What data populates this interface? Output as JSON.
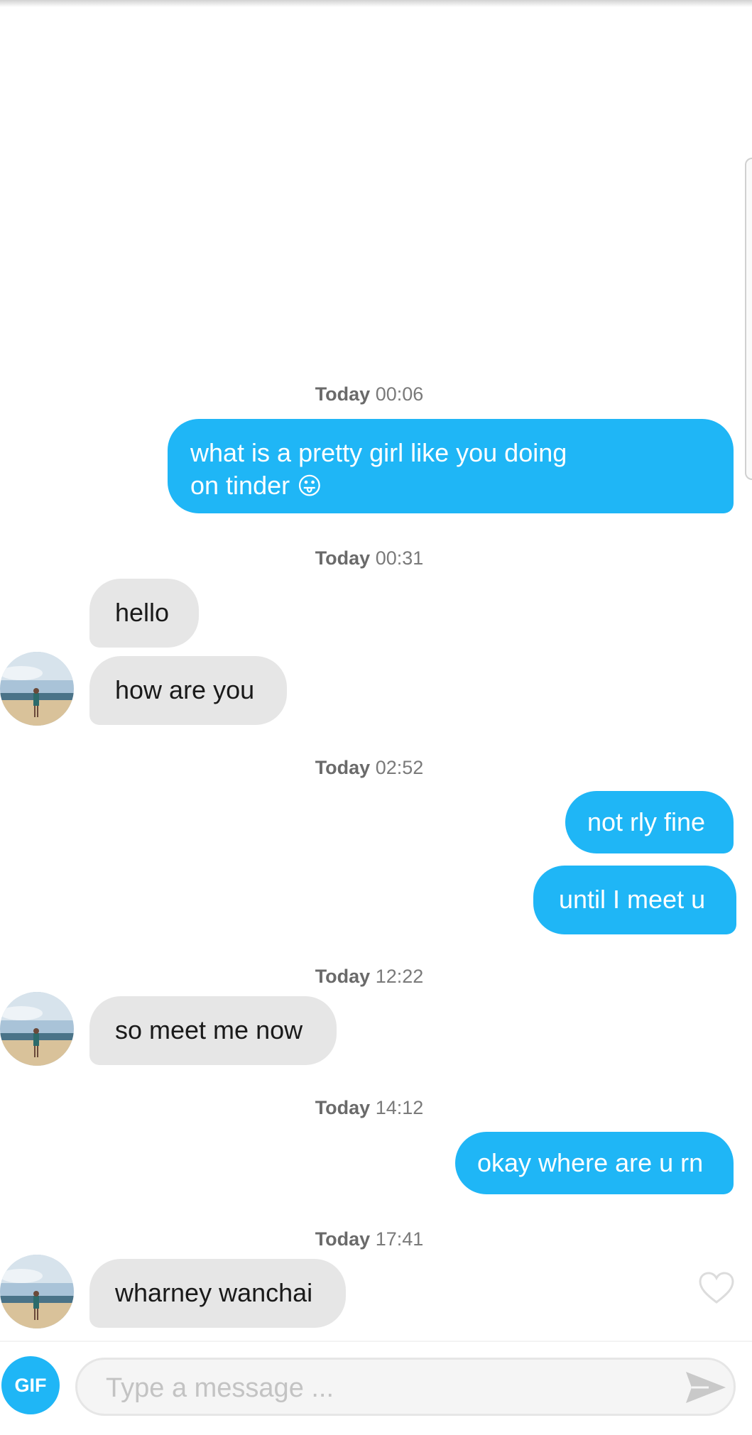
{
  "colors": {
    "outgoing": "#1fb6f6",
    "incoming": "#e6e6e6",
    "accent": "#1fb6f6"
  },
  "messages": [
    {
      "day": "Today",
      "time": "00:06"
    },
    {
      "text": "what is a pretty girl like you doing",
      "text2": "on tinder",
      "emoji": "😛"
    },
    {
      "day": "Today",
      "time": "00:31"
    },
    {
      "text": "hello"
    },
    {
      "text": "how are you"
    },
    {
      "day": "Today",
      "time": "02:52"
    },
    {
      "text": "not rly fine"
    },
    {
      "text": "until I meet u"
    },
    {
      "day": "Today",
      "time": "12:22"
    },
    {
      "text": "so meet me now"
    },
    {
      "day": "Today",
      "time": "14:12"
    },
    {
      "text": "okay where are u rn"
    },
    {
      "day": "Today",
      "time": "17:41"
    },
    {
      "text": "wharney wanchai"
    }
  ],
  "composer": {
    "gif_label": "GIF",
    "placeholder": "Type a message ...",
    "send_icon": "send-icon"
  },
  "icons": {
    "like": "heart-icon",
    "avatar": "match-avatar"
  }
}
